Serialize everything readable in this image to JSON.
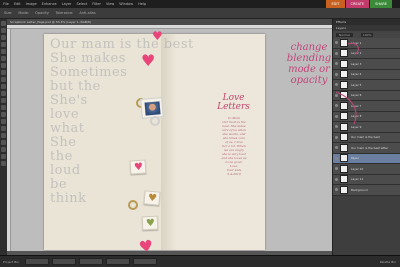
{
  "menu": {
    "items": [
      "File",
      "Edit",
      "Image",
      "Enhance",
      "Layer",
      "Select",
      "Filter",
      "View",
      "Window",
      "Help"
    ],
    "modes": [
      {
        "label": "EDIT",
        "color": "#c86020"
      },
      {
        "label": "CREATE",
        "color": "#c03a6a"
      },
      {
        "label": "SHARE",
        "color": "#3a8a3a"
      }
    ]
  },
  "options": {
    "items": [
      "Size:",
      "Mode:",
      "Opacity:",
      "Tolerance:",
      "Anti-alias"
    ]
  },
  "document": {
    "tab_label": "Scrapbook Letter_Page.psd @ 33.3% (Layer 1, RGB/8)"
  },
  "page": {
    "handwriting_lines": [
      "Our mam is the best",
      "She makes",
      "Sometimes",
      "but the",
      "She's",
      "love",
      "what",
      "She",
      "the",
      "loud",
      "be",
      "think"
    ],
    "love_title_1": "Love",
    "love_title_2": "Letters",
    "love_body_lines": [
      "To Mom",
      "Our mom is the",
      "best. She takes",
      "care of us when",
      "she works, and",
      "she takes care",
      "of us. I love",
      "her a lot. When",
      "we are angry",
      "she is very loud",
      "and she loves us",
      "to be good.",
      "Love,",
      "Your kids",
      "5-4-2010"
    ]
  },
  "layers_panel": {
    "header": "Effects",
    "subheader": "Layers",
    "blend_mode": "Normal",
    "opacity": "100%",
    "rows": [
      {
        "label": "Layer 1",
        "selected": false
      },
      {
        "label": "Layer 2",
        "selected": false
      },
      {
        "label": "Layer 3",
        "selected": false
      },
      {
        "label": "Layer 4",
        "selected": false
      },
      {
        "label": "Layer 5",
        "selected": false
      },
      {
        "label": "Layer 6",
        "selected": false
      },
      {
        "label": "Layer 7",
        "selected": false
      },
      {
        "label": "Layer 8",
        "selected": false
      },
      {
        "label": "Layer 9",
        "selected": false
      },
      {
        "label": "Our mam is the best",
        "selected": false
      },
      {
        "label": "Our mam is the best letter",
        "selected": false
      },
      {
        "label": "Paper",
        "selected": true
      },
      {
        "label": "Layer 10",
        "selected": false
      },
      {
        "label": "Layer 11",
        "selected": false
      },
      {
        "label": "Background",
        "selected": false
      }
    ]
  },
  "bottom": {
    "label": "Project Bin",
    "right_label": "Palette Bin"
  },
  "annotation": {
    "lines": [
      "change",
      "blending",
      "mode or",
      "opacity"
    ]
  }
}
